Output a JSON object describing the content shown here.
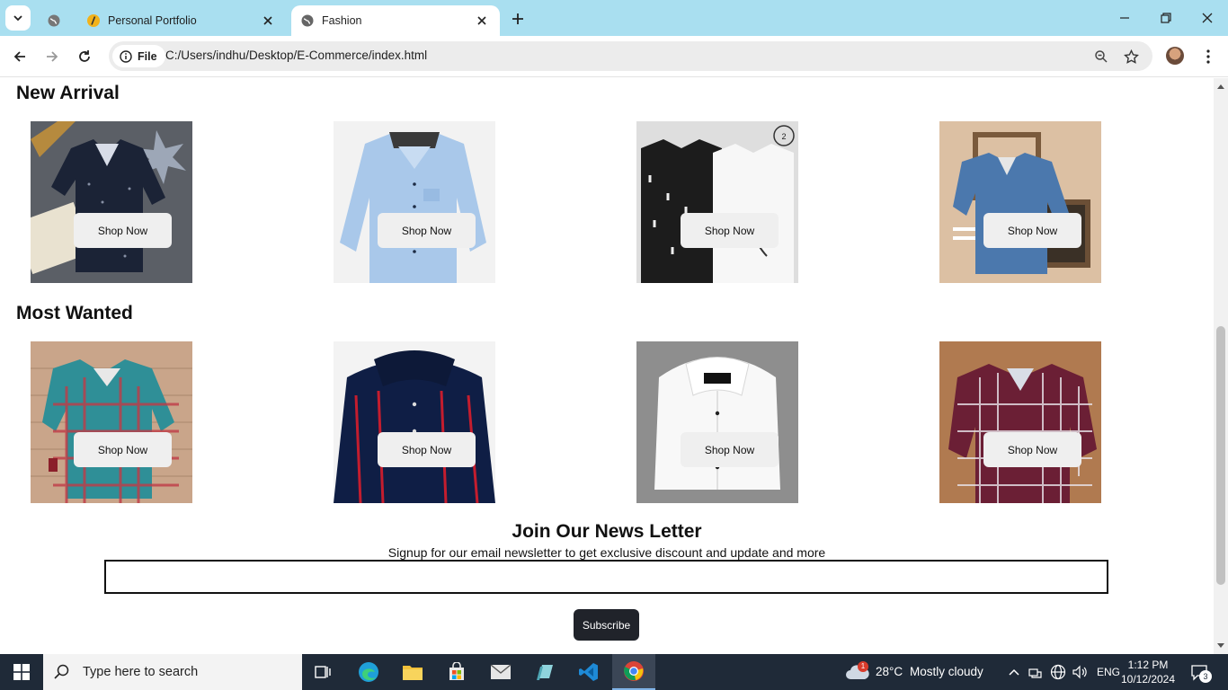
{
  "browser": {
    "tabs": [
      {
        "title": "Personal Portfolio",
        "favicon": "portfolio-favicon"
      },
      {
        "title": "Fashion",
        "favicon": "globe-icon",
        "active": true
      }
    ],
    "address": {
      "chip_label": "File",
      "url": "C:/Users/indhu/Desktop/E-Commerce/index.html"
    }
  },
  "page": {
    "sections": [
      {
        "title": "New Arrival",
        "products": [
          {
            "image": "navy-printed-shirt",
            "button": "Shop Now"
          },
          {
            "image": "light-blue-shirt",
            "button": "Shop Now"
          },
          {
            "image": "black-white-shirt-pack",
            "button": "Shop Now"
          },
          {
            "image": "denim-shirt",
            "button": "Shop Now"
          }
        ]
      },
      {
        "title": "Most Wanted",
        "products": [
          {
            "image": "teal-check-shirt",
            "button": "Shop Now"
          },
          {
            "image": "navy-red-stripe-shirt",
            "button": "Shop Now"
          },
          {
            "image": "white-formal-shirt",
            "button": "Shop Now"
          },
          {
            "image": "red-check-shirt",
            "button": "Shop Now"
          }
        ]
      }
    ],
    "newsletter": {
      "title": "Join Our News Letter",
      "subtitle": "Signup for our email newsletter to get exclusive discount and update and more",
      "input_value": "",
      "button": "Subscribe"
    }
  },
  "taskbar": {
    "search_placeholder": "Type here to search",
    "weather": {
      "temp": "28°C",
      "condition": "Mostly cloudy",
      "badge": "1"
    },
    "language": "ENG",
    "time": "1:12 PM",
    "date": "10/12/2024",
    "notification_count": "3"
  },
  "colors": {
    "tabbar": "#a9dff0",
    "taskbar": "#1f2a38",
    "subscribe_bg": "#20232a"
  }
}
